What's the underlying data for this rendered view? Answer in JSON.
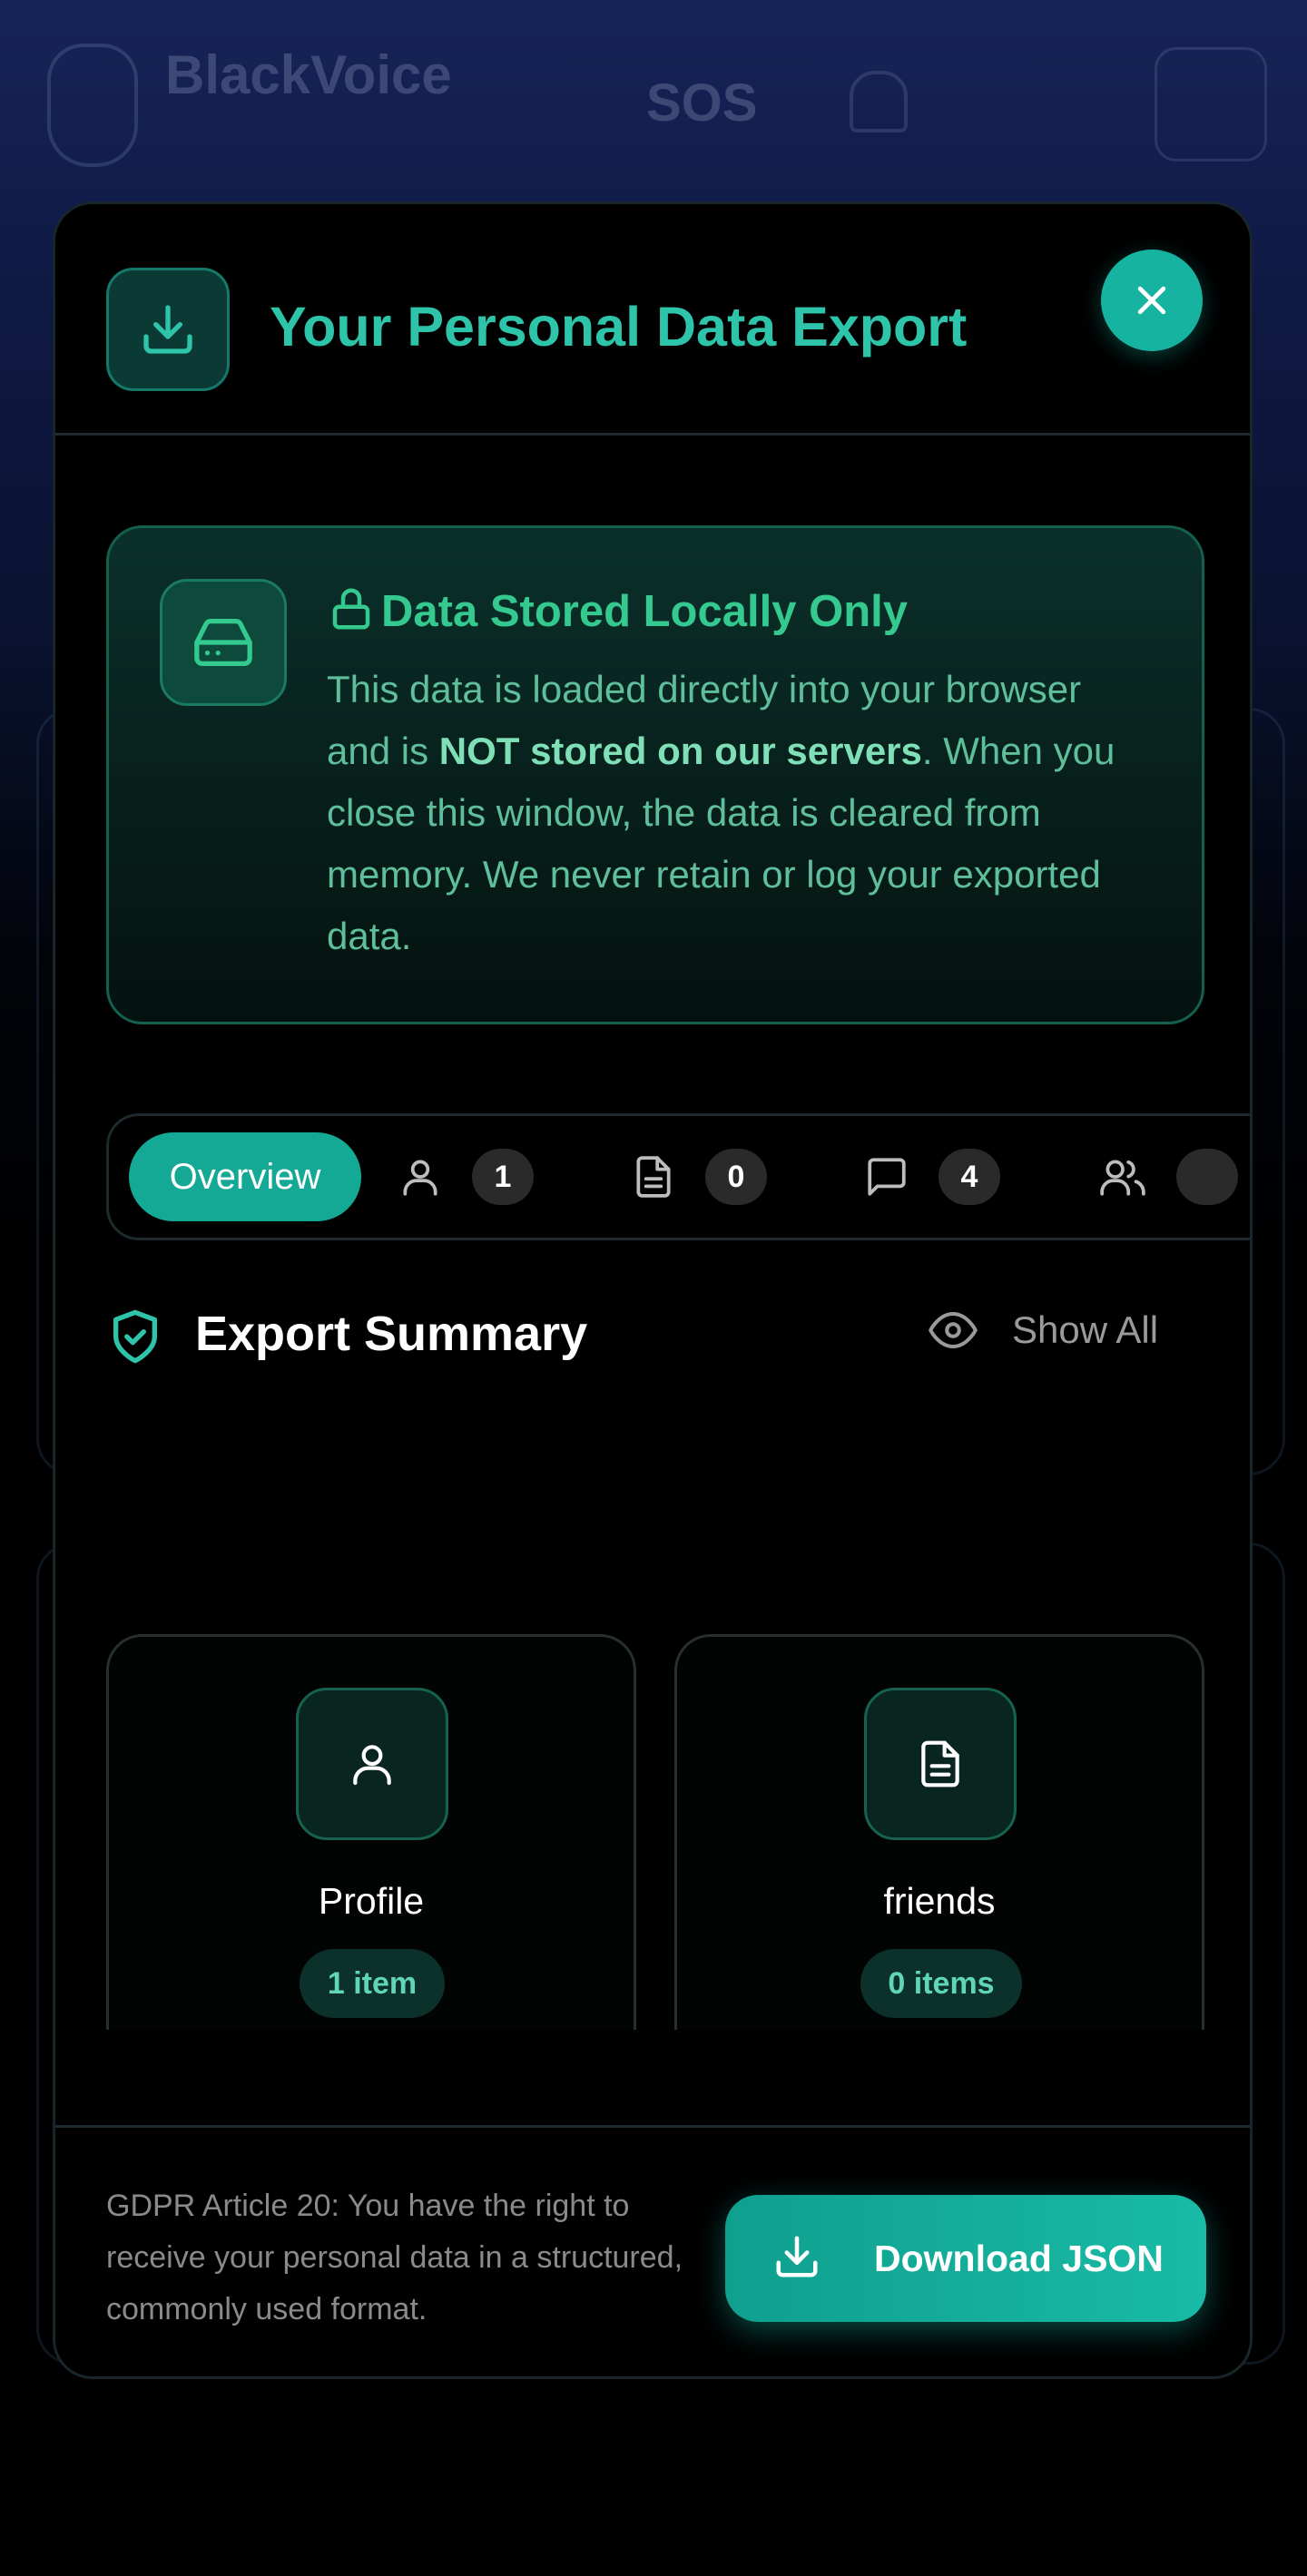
{
  "app": {
    "name": "BlackVoice",
    "tagline": "",
    "sos_label": "SOS"
  },
  "modal": {
    "title": "Your Personal Data Export",
    "notice": {
      "title": "Data Stored Locally Only",
      "text_before": "This data is loaded directly into your browser and is ",
      "text_bold": "NOT stored on our servers",
      "text_after": ". When you close this window, the data is cleared from memory. We never retain or log your exported data."
    },
    "tabs": [
      {
        "label": "Overview",
        "active": true
      },
      {
        "icon": "user-icon",
        "count": "1"
      },
      {
        "icon": "document-icon",
        "count": "0"
      },
      {
        "icon": "message-icon",
        "count": "4"
      },
      {
        "icon": "users-icon",
        "count": ""
      }
    ],
    "summary": {
      "title": "Export Summary",
      "show_all_label": "Show All"
    },
    "cards": [
      {
        "label": "Profile",
        "badge": "1 item",
        "icon": "user-icon"
      },
      {
        "label": "friends",
        "badge": "0 items",
        "icon": "document-icon"
      },
      {
        "label": "",
        "badge": "",
        "icon": "message-icon"
      },
      {
        "label": "",
        "badge": "",
        "icon": "users-icon"
      }
    ],
    "footer": {
      "text": "GDPR Article 20: You have the right to receive your personal data in a structured, commonly used format.",
      "download_label": "Download JSON"
    }
  },
  "colors": {
    "accent": "#16b3a0",
    "accent_text": "#2ec4aa",
    "notice_green": "#34c98e",
    "background": "#000000"
  }
}
